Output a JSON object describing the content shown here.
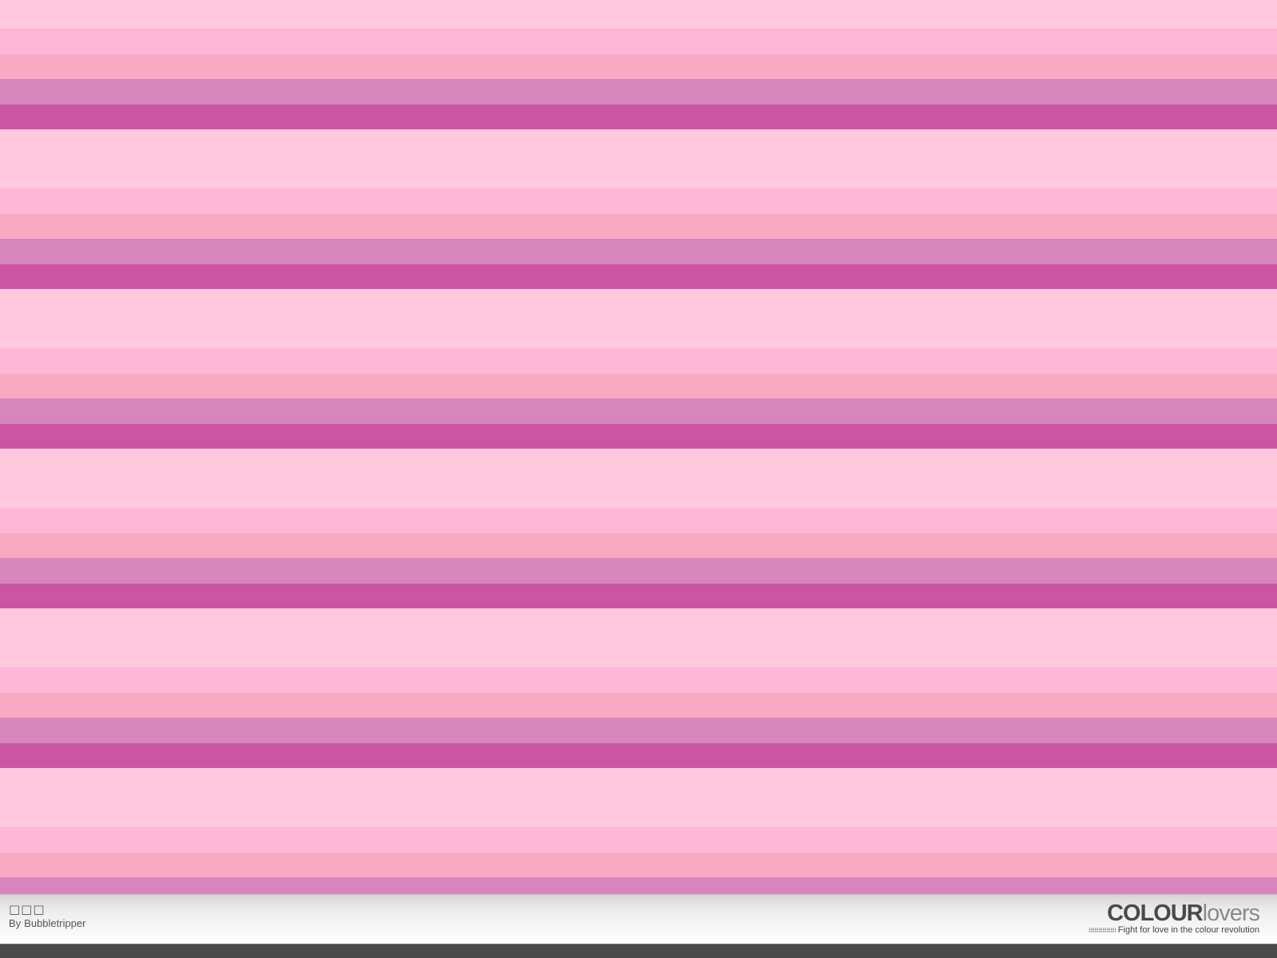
{
  "pattern": {
    "title": "□□□",
    "author_prefix": "By",
    "author": "Bubbletripper",
    "palette": [
      "#ffc8dd",
      "#ffb6d7",
      "#f8aac3",
      "#d686bc",
      "#cc55a3"
    ]
  },
  "logo": {
    "name_bold": "COLOUR",
    "name_light": "lovers",
    "tagline": "Fight for love in the colour revolution"
  }
}
